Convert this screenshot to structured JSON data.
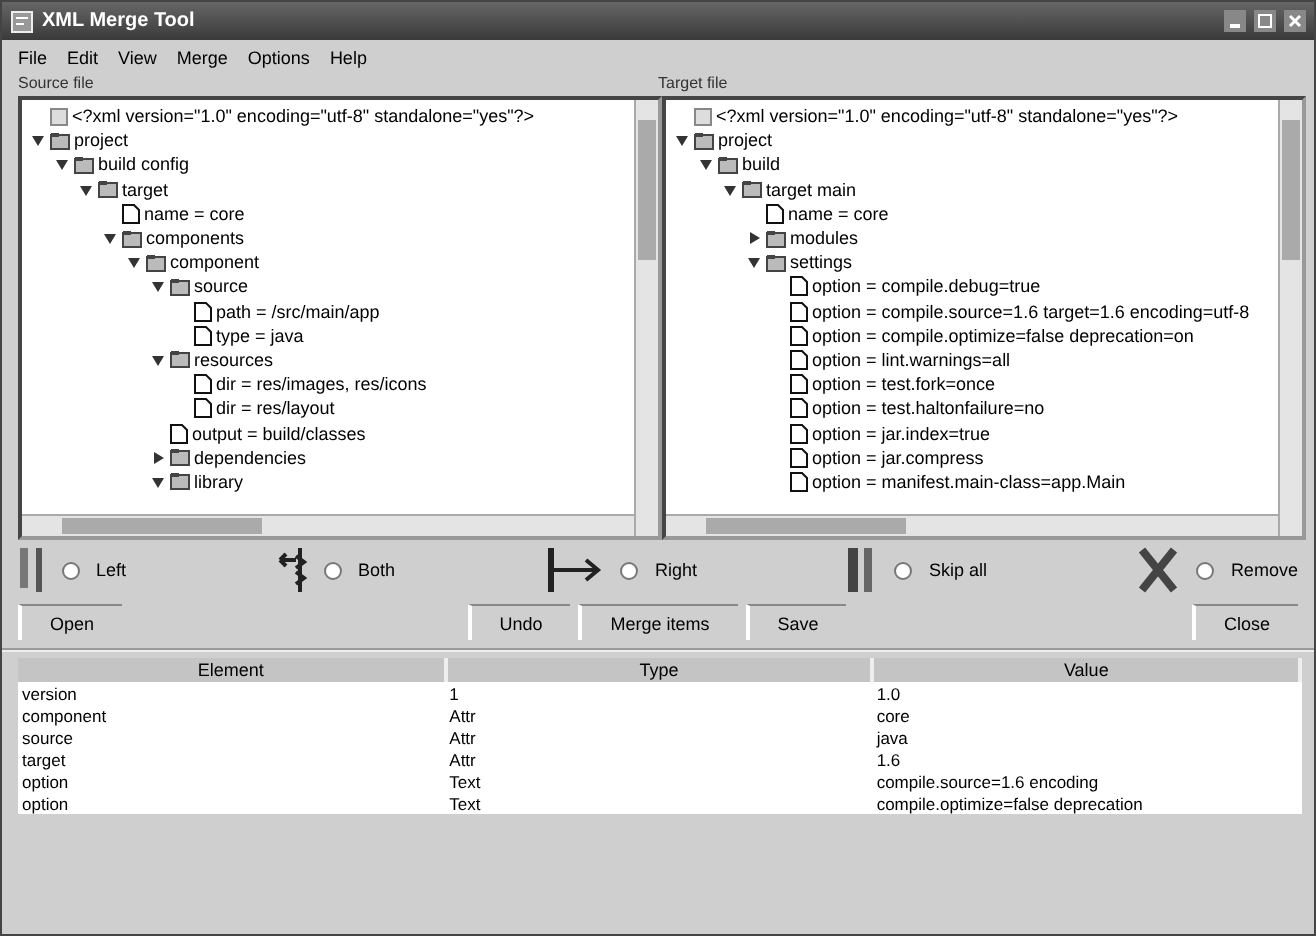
{
  "window": {
    "title": "XML Merge Tool"
  },
  "menu": [
    "File",
    "Edit",
    "View",
    "Merge",
    "Options",
    "Help"
  ],
  "left_pane": {
    "label": "Source file",
    "tree": [
      {
        "kind": "declaration",
        "label": "<?xml version=\"1.0\" encoding=\"utf-8\" standalone=\"yes\"?>"
      },
      {
        "kind": "element",
        "label": "project",
        "expanded": true,
        "children": [
          {
            "kind": "element",
            "label": "build config",
            "expanded": true,
            "children": [
              {
                "kind": "element",
                "label": "target",
                "expanded": true,
                "children": [
                  {
                    "kind": "leaf",
                    "label": "name = core"
                  },
                  {
                    "kind": "element",
                    "label": "components",
                    "expanded": true,
                    "children": [
                      {
                        "kind": "element",
                        "label": "component",
                        "expanded": true,
                        "children": [
                          {
                            "kind": "element",
                            "label": "source",
                            "expanded": true,
                            "children": [
                              {
                                "kind": "leaf",
                                "label": "path = /src/main/app"
                              },
                              {
                                "kind": "leaf",
                                "label": "type = java"
                              }
                            ]
                          },
                          {
                            "kind": "element",
                            "label": "resources",
                            "expanded": true,
                            "children": [
                              {
                                "kind": "leaf",
                                "label": "dir = res/images, res/icons"
                              },
                              {
                                "kind": "leaf",
                                "label": "dir = res/layout"
                              }
                            ]
                          },
                          {
                            "kind": "leaf",
                            "label": "output = build/classes"
                          },
                          {
                            "kind": "element",
                            "label": "dependencies",
                            "expanded": false
                          },
                          {
                            "kind": "element",
                            "label": "library",
                            "expanded": true
                          }
                        ]
                      }
                    ]
                  }
                ]
              }
            ]
          }
        ]
      }
    ]
  },
  "right_pane": {
    "label": "Target file",
    "tree": [
      {
        "kind": "declaration",
        "label": "<?xml version=\"1.0\" encoding=\"utf-8\" standalone=\"yes\"?>"
      },
      {
        "kind": "element",
        "label": "project",
        "expanded": true,
        "children": [
          {
            "kind": "element",
            "label": "build",
            "expanded": true,
            "children": [
              {
                "kind": "element",
                "label": "target main",
                "expanded": true,
                "children": [
                  {
                    "kind": "leaf",
                    "label": "name = core"
                  },
                  {
                    "kind": "element",
                    "label": "modules",
                    "expanded": false
                  },
                  {
                    "kind": "element",
                    "label": "settings",
                    "expanded": true,
                    "children": [
                      {
                        "kind": "leaf",
                        "label": "option = compile.debug=true"
                      },
                      {
                        "kind": "leaf",
                        "label": "option = compile.source=1.6 target=1.6 encoding=utf-8"
                      },
                      {
                        "kind": "leaf",
                        "label": "option = compile.optimize=false deprecation=on"
                      },
                      {
                        "kind": "leaf",
                        "label": "option = lint.warnings=all"
                      },
                      {
                        "kind": "leaf",
                        "label": "option = test.fork=once"
                      },
                      {
                        "kind": "leaf",
                        "label": "option = test.haltonfailure=no"
                      },
                      {
                        "kind": "leaf",
                        "label": "option = jar.index=true"
                      },
                      {
                        "kind": "leaf",
                        "label": "option = jar.compress"
                      },
                      {
                        "kind": "leaf",
                        "label": "option = manifest.main-class=app.Main"
                      }
                    ]
                  }
                ]
              }
            ]
          }
        ]
      }
    ]
  },
  "merge_actions": [
    {
      "kind": "copy",
      "label": "Left",
      "selected": false
    },
    {
      "kind": "swap",
      "label": "Both",
      "selected": false
    },
    {
      "kind": "push",
      "label": "Right",
      "selected": false
    },
    {
      "kind": "pause",
      "label": "Skip all",
      "selected": false
    },
    {
      "kind": "delete",
      "label": "Remove",
      "selected": false
    }
  ],
  "buttons": [
    "Open",
    "Undo",
    "Merge items",
    "Save",
    "Close"
  ],
  "table": {
    "columns": [
      "Element",
      "Type",
      "Value"
    ],
    "rows": [
      [
        "version",
        "1",
        "1.0"
      ],
      [
        "component",
        "Attr",
        "core"
      ],
      [
        "source",
        "Attr",
        "java"
      ],
      [
        "target",
        "Attr",
        "1.6"
      ],
      [
        "option",
        "Text",
        "compile.source=1.6 encoding"
      ],
      [
        "option",
        "Text",
        "compile.optimize=false deprecation"
      ]
    ]
  }
}
